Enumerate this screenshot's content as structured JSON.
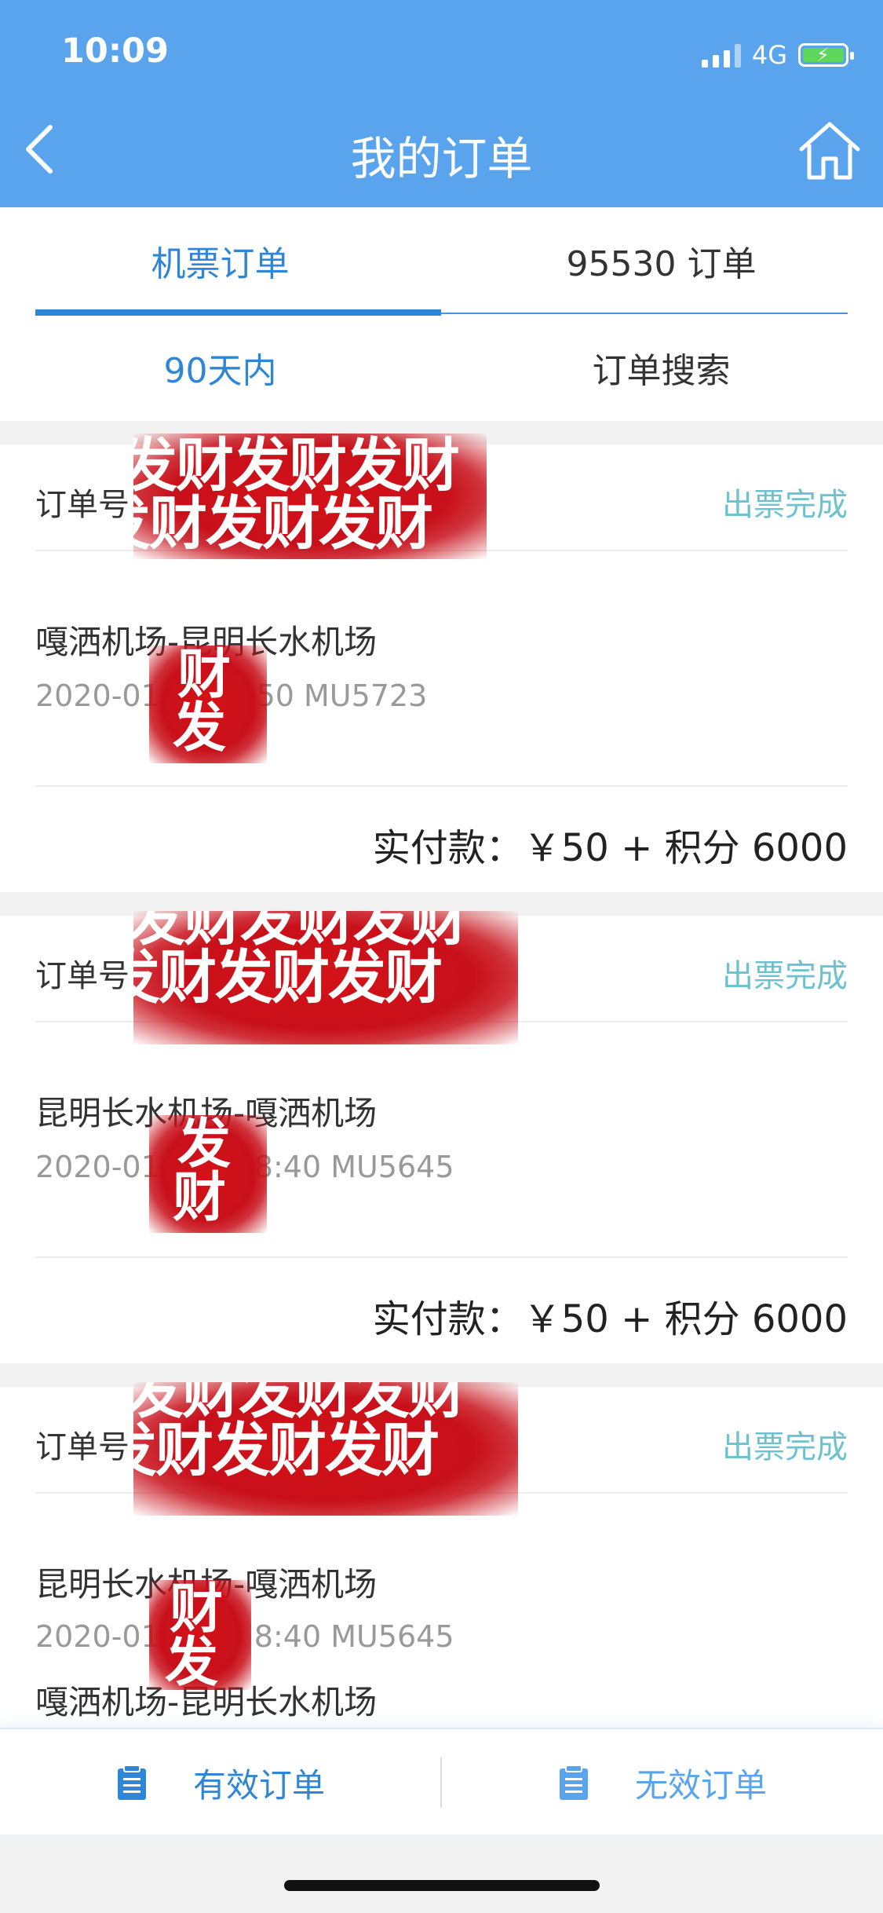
{
  "status_bar": {
    "time": "10:09",
    "network": "4G"
  },
  "header": {
    "title": "我的订单"
  },
  "tabs": [
    {
      "label": "机票订单"
    },
    {
      "label": "95530 订单"
    }
  ],
  "filters": [
    {
      "label": "90天内"
    },
    {
      "label": "订单搜索"
    }
  ],
  "orders": [
    {
      "order_label": "订单号",
      "status": "出票完成",
      "route": "嘎洒机场-昆明长水机场",
      "flight_visible": "2020-01 :50 MU5723",
      "flight_prefix": "2020-01",
      "flight_suffix": ":50 MU5723",
      "price": "实付款：￥50 + 积分 6000"
    },
    {
      "order_label": "订单号",
      "status": "出票完成",
      "route": "昆明长水机场-嘎洒机场",
      "flight_prefix": "2020-01",
      "flight_suffix": "8:40 MU5645",
      "price": "实付款：￥50 + 积分 6000"
    },
    {
      "order_label": "订单号",
      "status": "出票完成",
      "route": "昆明长水机场-嘎洒机场",
      "flight_prefix": "2020-01",
      "flight_suffix": "8:40 MU5645",
      "route_2": "嘎洒机场-昆明长水机场"
    }
  ],
  "redaction_text": "发财发财发财",
  "bottom_bar": {
    "valid_label": "有效订单",
    "invalid_label": "无效订单"
  },
  "colors": {
    "header_bg": "#5aa4ed",
    "accent": "#2f86d6",
    "status": "#6cc3cf",
    "stamp": "#c8101a"
  },
  "icons": {
    "back": "chevron-left-icon",
    "home": "home-icon",
    "valid": "clipboard-icon",
    "invalid": "clipboard-icon"
  }
}
